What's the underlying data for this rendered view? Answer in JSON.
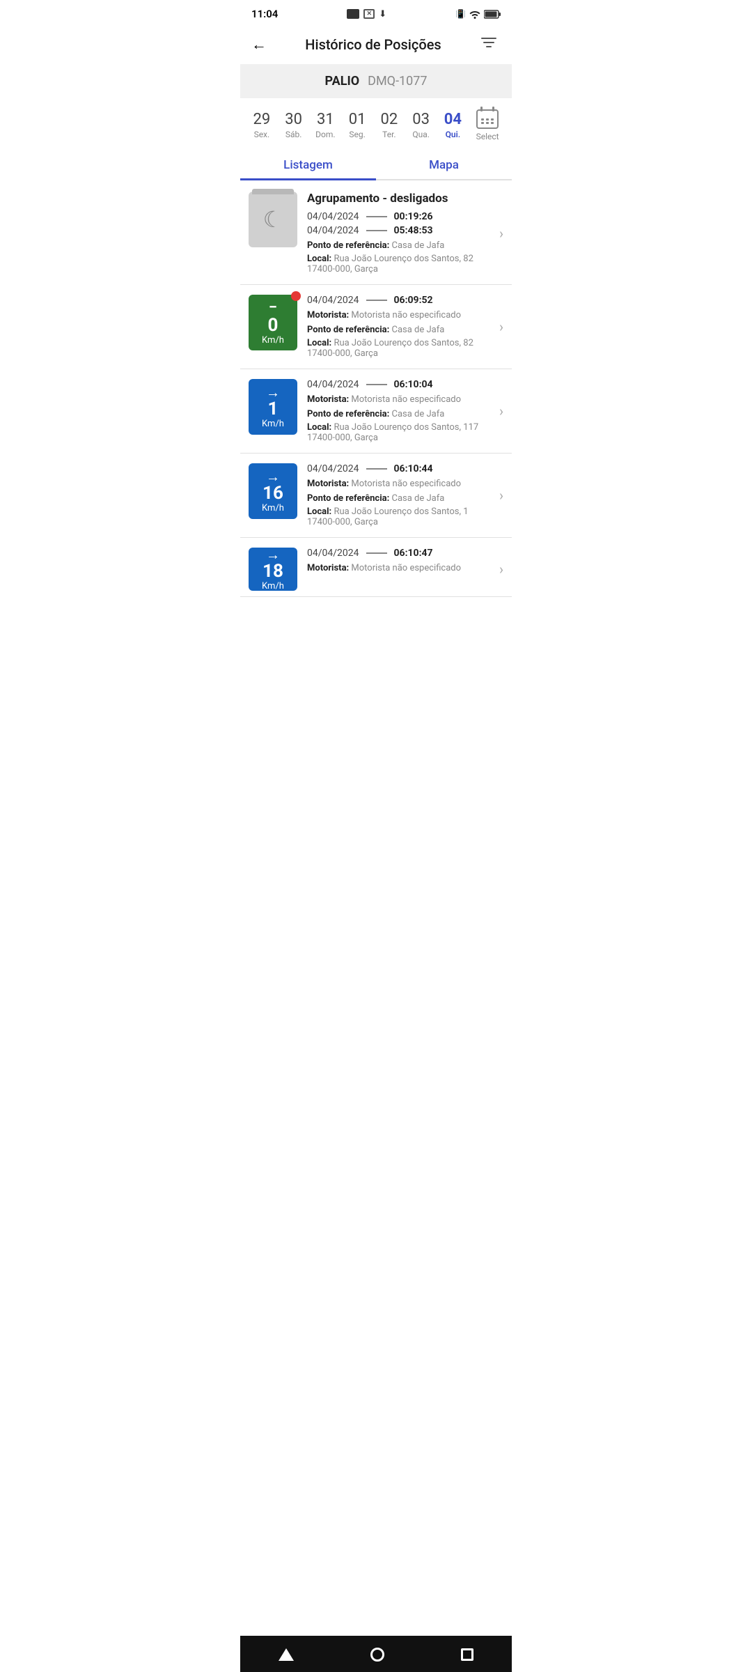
{
  "statusBar": {
    "time": "11:04"
  },
  "header": {
    "title": "Histórico de Posições",
    "backLabel": "←",
    "filterLabel": "⊽"
  },
  "vehicle": {
    "name": "PALIO",
    "plate": "DMQ-1077"
  },
  "dates": [
    {
      "num": "29",
      "day": "Sex.",
      "active": false
    },
    {
      "num": "30",
      "day": "Sáb.",
      "active": false
    },
    {
      "num": "31",
      "day": "Dom.",
      "active": false
    },
    {
      "num": "01",
      "day": "Seg.",
      "active": false
    },
    {
      "num": "02",
      "day": "Ter.",
      "active": false
    },
    {
      "num": "03",
      "day": "Qua.",
      "active": false
    },
    {
      "num": "04",
      "day": "Qui.",
      "active": true
    }
  ],
  "calendarLabel": "Select",
  "tabs": [
    {
      "id": "listagem",
      "label": "Listagem",
      "active": true
    },
    {
      "id": "mapa",
      "label": "Mapa",
      "active": false
    }
  ],
  "groupItem": {
    "title": "Agrupamento - desligados",
    "startDate": "04/04/2024",
    "startTime": "00:19:26",
    "endDate": "04/04/2024",
    "endTime": "05:48:53",
    "referenceLabelText": "Ponto de referência:",
    "referenceValue": "Casa de Jafa",
    "localLabelText": "Local:",
    "localValue": "Rua João Lourenço dos Santos, 82 17400-000, Garça"
  },
  "positions": [
    {
      "speed": "0",
      "unit": "Km/h",
      "colorClass": "green",
      "hasNotification": true,
      "showMinus": true,
      "showArrow": false,
      "date": "04/04/2024",
      "time": "06:09:52",
      "motoristLabel": "Motorista:",
      "motoristValue": "Motorista não especificado",
      "referenceLabelText": "Ponto de referência:",
      "referenceValue": "Casa de Jafa",
      "localLabelText": "Local:",
      "localValue": "Rua João Lourenço dos Santos, 82 17400-000, Garça"
    },
    {
      "speed": "1",
      "unit": "Km/h",
      "colorClass": "blue",
      "hasNotification": false,
      "showMinus": false,
      "showArrow": true,
      "date": "04/04/2024",
      "time": "06:10:04",
      "motoristLabel": "Motorista:",
      "motoristValue": "Motorista não especificado",
      "referenceLabelText": "Ponto de referência:",
      "referenceValue": "Casa de Jafa",
      "localLabelText": "Local:",
      "localValue": "Rua João Lourenço dos Santos, 117 17400-000, Garça"
    },
    {
      "speed": "16",
      "unit": "Km/h",
      "colorClass": "blue",
      "hasNotification": false,
      "showMinus": false,
      "showArrow": true,
      "date": "04/04/2024",
      "time": "06:10:44",
      "motoristLabel": "Motorista:",
      "motoristValue": "Motorista não especificado",
      "referenceLabelText": "Ponto de referência:",
      "referenceValue": "Casa de Jafa",
      "localLabelText": "Local:",
      "localValue": "Rua João Lourenço dos Santos, 1 17400-000, Garça"
    },
    {
      "speed": "18",
      "unit": "Km/h",
      "colorClass": "blue",
      "hasNotification": false,
      "showMinus": false,
      "showArrow": true,
      "date": "04/04/2024",
      "time": "06:10:47",
      "motoristLabel": "Motorista:",
      "motoristValue": "Motorista não especificado",
      "referenceLabelText": "Ponto de referência:",
      "referenceValue": "",
      "localLabelText": "",
      "localValue": ""
    }
  ]
}
